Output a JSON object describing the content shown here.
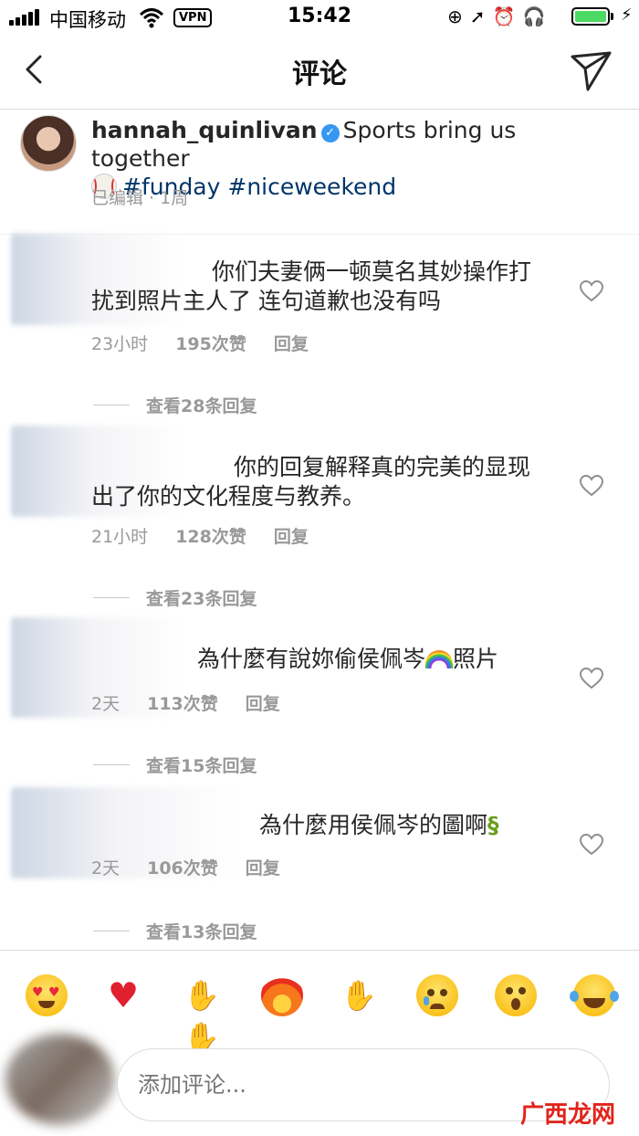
{
  "status_bar": {
    "carrier": "中国移动",
    "vpn": "VPN",
    "time": "15:42"
  },
  "nav": {
    "title": "评论"
  },
  "caption": {
    "username": "hannah_quinlivan",
    "text": "Sports bring us together",
    "hashtags": "#funday #niceweekend",
    "meta": "已编辑 · 1周"
  },
  "comments": [
    {
      "text": "你们夫妻俩一顿莫名其妙操作打扰到照片主人了 连句道歉也没有吗",
      "time": "23小时",
      "likes": "195次赞",
      "reply": "回复",
      "view_replies": "查看28条回复"
    },
    {
      "text": "你的回复解释真的完美的显现出了你的文化程度与教养。",
      "time": "21小时",
      "likes": "128次赞",
      "reply": "回复",
      "view_replies": "查看23条回复"
    },
    {
      "text": "為什麼有說妳偷侯佩岑",
      "text_suffix": "照片",
      "time": "2天",
      "likes": "113次赞",
      "reply": "回复",
      "view_replies": "查看15条回复"
    },
    {
      "text": "為什麼用侯佩岑的圖啊",
      "time": "2天",
      "likes": "106次赞",
      "reply": "回复",
      "view_replies": "查看13条回复"
    }
  ],
  "emoji_bar": [
    "heart-eyes",
    "red-heart",
    "raising-hands",
    "fire",
    "clapping-hands",
    "crying-face",
    "surprised-face",
    "tears-of-joy"
  ],
  "comment_input": {
    "placeholder": "添加评论..."
  },
  "watermark": "广西龙网",
  "colors": {
    "link": "#003569",
    "meta": "#999999",
    "verified": "#3897f0",
    "battery": "#4cd964"
  }
}
